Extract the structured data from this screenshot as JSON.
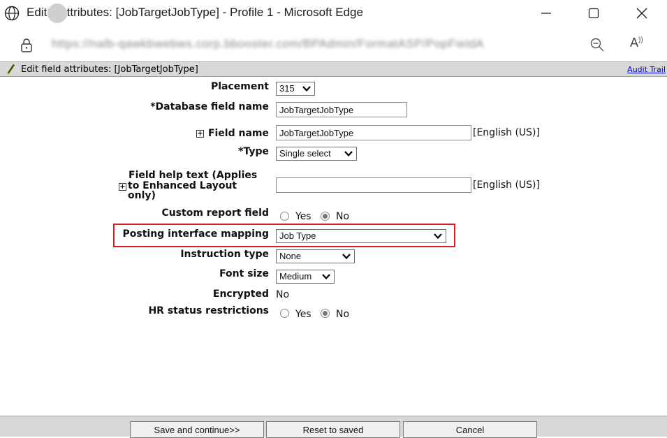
{
  "window": {
    "title": "Edit  d attributes: [JobTargetJobType] - Profile 1 - Microsoft Edge",
    "url": "https://nalb-qawkbwebws.corp.bbooster.com/BPAdmin/FormatASP/PopFieldA"
  },
  "icons": {
    "globe": "globe-icon",
    "minimize": "minimize-icon",
    "maximize": "maximize-icon",
    "close": "close-icon",
    "lock": "lock-icon",
    "zoom": "zoom-out-icon",
    "read_aloud": "read-aloud-icon",
    "pencil": "pencil-icon"
  },
  "header": {
    "title": "Edit field attributes: [JobTargetJobType]",
    "audit_link": "Audit Trail"
  },
  "form": {
    "placement": {
      "label": "Placement",
      "value": "315"
    },
    "db_field_name": {
      "label": "*Database field name",
      "value": "JobTargetJobType"
    },
    "field_name": {
      "label": "Field name",
      "value": "JobTargetJobType",
      "suffix": "[English (US)]",
      "expand": "+"
    },
    "type": {
      "label": "*Type",
      "value": "Single select"
    },
    "help_text": {
      "label_line1": "Field help text (Applies",
      "label_line2": "to Enhanced Layout",
      "label_line3": "only)",
      "value": "",
      "suffix": "[English (US)]",
      "expand": "+"
    },
    "custom_report": {
      "label": "Custom report field",
      "yes": "Yes",
      "no": "No",
      "selected": "No"
    },
    "posting_mapping": {
      "label": "Posting interface mapping",
      "value": "Job Type"
    },
    "instruction_type": {
      "label": "Instruction type",
      "value": "None"
    },
    "font_size": {
      "label": "Font size",
      "value": "Medium"
    },
    "encrypted": {
      "label": "Encrypted",
      "value": "No"
    },
    "hr_status": {
      "label": "HR status restrictions",
      "yes": "Yes",
      "no": "No",
      "selected": "No"
    }
  },
  "buttons": {
    "save": "Save and continue>>",
    "reset": "Reset to saved",
    "cancel": "Cancel"
  },
  "colors": {
    "highlight": "#d42020",
    "header_bg": "#d8d8d8",
    "link": "#0000cc"
  }
}
